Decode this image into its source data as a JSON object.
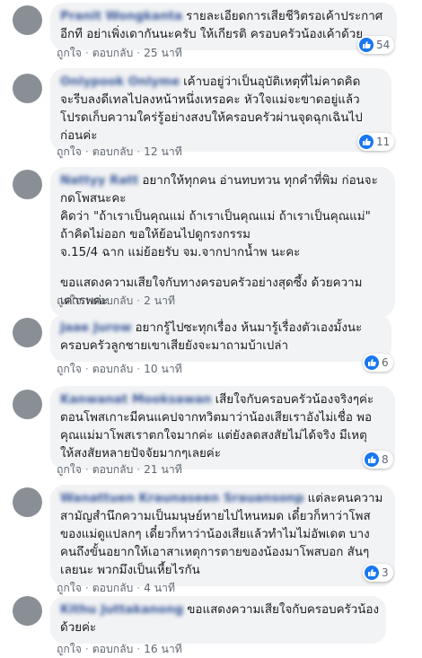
{
  "comments": [
    {
      "author": "Pranit Wongkanta",
      "lines": [
        "รายละเอียดการเสียชีวิตรอเค้าประกาศ",
        "อีกที อย่าเพิ่งเดากันนะครับ ให้เกียรติ ครอบครัวน้องเค้าด้วย"
      ],
      "like_label": "ถูกใจ",
      "reply_label": "ตอบกลับ",
      "time": "25 นาที",
      "reactions": "54"
    },
    {
      "author": "Onlypook Onlyme",
      "lines": [
        "เค้าบอยู่ว่าเป็นอุบัติเหตุที่ไม่คาดคิด",
        "จะรีบลงดีเทลไปลงหน้าหนึ่งเหรอคะ หัวใจแม่จะขาดอยู่แล้ว",
        "โปรดเก็บความใคร่รู้อย่างสงบให้ครอบครัวผ่านจุดฉุกเฉินไป",
        "ก่อนค่ะ"
      ],
      "like_label": "ถูกใจ",
      "reply_label": "ตอบกลับ",
      "time": "12 นาที",
      "reactions": "11"
    },
    {
      "author": "Nattyy Ratt",
      "lines": [
        "อยากให้ทุกคน อ่านทบทวน ทุกคำที่พิม ก่อนจะ",
        "กดโพสนะคะ",
        "คิดว่า \"ถ้าเราเป็นคุณแม่ ถ้าเราเป็นคุณแม่ ถ้าเราเป็นคุณแม่\"",
        "ถ้าคิดไม่ออก ขอให้ย้อนไปดูกรงกรรม",
        "จ.15/4 ฉาก แม่ย้อยรับ จม.จากปากน้ำพ นะคะ",
        "",
        "ขอแสดงความเสียใจกับทางครอบครัวอย่างสุดซึ้ง ด้วยความ",
        "เคารพค่ะ"
      ],
      "like_label": "ถูกใจ",
      "reply_label": "ตอบกลับ",
      "time": "2 นาที",
      "reactions": ""
    },
    {
      "author": "Jaae Jurow",
      "lines": [
        "อยากรู้ไปซะทุกเรื่อง ห้นมารู้เรื่องตัวเองมั้งนะ",
        "ครอบครัวลูกชายเขาเสียยังจะมาถามบ้าเปล่า"
      ],
      "like_label": "ถูกใจ",
      "reply_label": "ตอบกลับ",
      "time": "10 นาที",
      "reactions": "6"
    },
    {
      "author": "Kanwanat Mooksawan",
      "lines": [
        "เสียใจกับครอบครัวน้องจริงๆค่ะ",
        "ตอนโพสเกาะมีคนแคปจากทวิตมาว่าน้องเสียเราอังไม่เชื่อ พอ",
        "คุณแม่มาโพสเราตกใจมากค่ะ แต่ยังลดสงสัยไม่ได้จริง มีเหตุ",
        "ให้สงสัยหลายปัจจัยมากๆเลยค่ะ"
      ],
      "like_label": "ถูกใจ",
      "reply_label": "ตอบกลับ",
      "time": "21 นาที",
      "reactions": "8"
    },
    {
      "author": "Wanattuen Kraunaseen Srauansonp",
      "lines": [
        "แต่ละคนความ",
        "สามัญสำนึกความเป็นมนุษย์หายไปไหนหมด เดี๋ยวก็หาว่าโพส",
        "ของแม่ดูแปลกๆ เดี๋ยวก็หาว่าน้องเสียแล้วทำไมไม่อัพเดต บาง",
        "คนถึงขั้นอยากให้เอาสาเหตุการตายของน้องมาโพสบอก สันๆ",
        "เลยนะ พวกมึงเป็นเหี้ยไรกัน"
      ],
      "like_label": "ถูกใจ",
      "reply_label": "ตอบกลับ",
      "time": "4 นาที",
      "reactions": "3"
    },
    {
      "author": "Kithu Juttakanong",
      "lines": [
        "ขอแสดงความเสียใจกับครอบครัวน้อง",
        "ด้วยค่ะ"
      ],
      "like_label": "ถูกใจ",
      "reply_label": "ตอบกลับ",
      "time": "16 นาที",
      "reactions": ""
    }
  ],
  "colors": {
    "link": "#385898",
    "bubble": "#f2f3f5",
    "like_blue": "#1877f2",
    "meta": "#606770"
  },
  "icons": {
    "reaction": "thumbs-up-icon"
  }
}
